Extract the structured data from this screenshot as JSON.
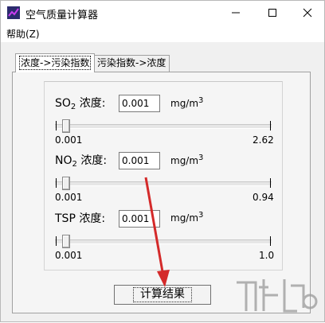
{
  "window": {
    "title": "空气质量计算器",
    "minimize_glyph": "—",
    "maximize_glyph": "☐",
    "close_glyph": "✕"
  },
  "menu": {
    "help": "帮助(Z)"
  },
  "tabs": [
    {
      "label": "浓度->污染指数",
      "active": true
    },
    {
      "label": "污染指数->浓度",
      "active": false
    }
  ],
  "pollutants": {
    "so2": {
      "name_main": "SO",
      "name_sub": "2",
      "suffix": " 浓度:",
      "value": "0.001",
      "unit_main": "mg/m",
      "unit_sup": "3",
      "min": "0.001",
      "max": "2.62",
      "level": 0.0
    },
    "no2": {
      "name_main": "NO",
      "name_sub": "2",
      "suffix": " 浓度:",
      "value": "0.001",
      "unit_main": "mg/m",
      "unit_sup": "3",
      "min": "0.001",
      "max": "0.94",
      "level": 0.0
    },
    "tsp": {
      "name_main": "TSP",
      "suffix": " 浓度:",
      "value": "0.001",
      "unit_main": "mg/m",
      "unit_sup": "3",
      "min": "0.001",
      "max": "1.0",
      "level": 0.0
    }
  },
  "button": {
    "calculate": "计算结果"
  },
  "colors": {
    "arrow": "#d42a2a",
    "icon_bg": "#2b2b6e",
    "icon_line": "#c93cf0"
  }
}
